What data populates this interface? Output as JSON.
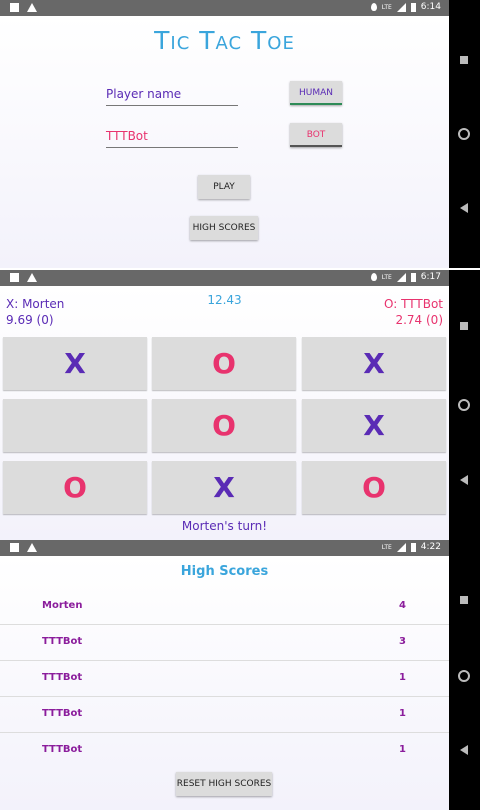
{
  "status_bars": [
    {
      "time": "6:14",
      "network": "LTE"
    },
    {
      "time": "6:17",
      "network": "LTE"
    },
    {
      "time": "4:22",
      "network": "LTE"
    }
  ],
  "setup": {
    "title": "Tic Tac Toe",
    "player1": {
      "placeholder": "Player name",
      "value": "",
      "type_label": "HUMAN"
    },
    "player2": {
      "value": "TTTBot",
      "type_label": "BOT"
    },
    "play_label": "PLAY",
    "high_scores_label": "HIGH SCORES"
  },
  "game": {
    "player_x": {
      "label": "X:  Morten",
      "score": "9.69  (0)"
    },
    "player_o": {
      "label": "O:  TTTBot",
      "score": "2.74  (0)"
    },
    "timer": "12.43",
    "board": [
      [
        "X",
        "O",
        "X"
      ],
      [
        "",
        "O",
        "X"
      ],
      [
        "O",
        "X",
        "O"
      ]
    ],
    "status": "Morten's turn!"
  },
  "high_scores": {
    "title": "High Scores",
    "rows": [
      {
        "name": "Morten",
        "score": "4"
      },
      {
        "name": "TTTBot",
        "score": "3"
      },
      {
        "name": "TTTBot",
        "score": "1"
      },
      {
        "name": "TTTBot",
        "score": "1"
      },
      {
        "name": "TTTBot",
        "score": "1"
      }
    ],
    "reset_label": "RESET HIGH SCORES"
  },
  "colors": {
    "accent_blue": "#3aa5dc",
    "x_purple": "#5a2bb5",
    "o_pink": "#e8336e",
    "score_purple": "#8b1d9c"
  },
  "icons": [
    "image-icon",
    "warning-icon",
    "location-icon",
    "signal-icon",
    "battery-icon",
    "recents-icon",
    "home-icon",
    "back-icon"
  ]
}
